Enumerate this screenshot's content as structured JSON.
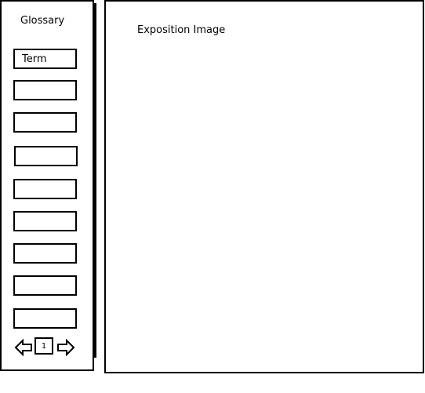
{
  "sidebar": {
    "title": "Glossary",
    "terms": [
      {
        "label": "Term"
      },
      {
        "label": ""
      },
      {
        "label": ""
      },
      {
        "label": ""
      },
      {
        "label": ""
      },
      {
        "label": ""
      },
      {
        "label": ""
      },
      {
        "label": ""
      },
      {
        "label": ""
      }
    ],
    "pager": {
      "current_page": "1",
      "prev_icon": "arrow-left-icon",
      "next_icon": "arrow-right-icon"
    }
  },
  "main": {
    "label": "Exposition Image"
  }
}
